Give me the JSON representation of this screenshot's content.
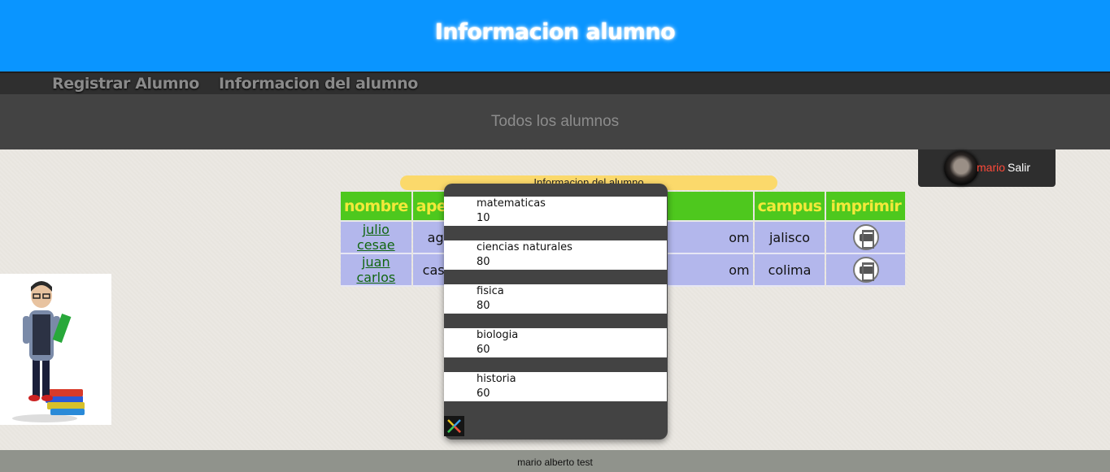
{
  "header": {
    "title": "Informacion alumno"
  },
  "nav": {
    "items": [
      {
        "label": "Registrar Alumno"
      },
      {
        "label": "Informacion del alumno"
      }
    ]
  },
  "subnav": {
    "label": "Todos los alumnos"
  },
  "user": {
    "name": "mario",
    "logout_label": "Salir"
  },
  "table": {
    "caption": "Informacion del alumno",
    "headers": [
      "nombre",
      "ape",
      "",
      "campus",
      "imprimir"
    ],
    "rows": [
      {
        "nombre": "julio cesae",
        "apellido": "agu",
        "correo": "om",
        "campus": "jalisco"
      },
      {
        "nombre": "juan carlos",
        "apellido": "cast",
        "correo": "om",
        "campus": "colima"
      }
    ]
  },
  "grades_modal": {
    "subjects": [
      {
        "name": "matematicas",
        "grade": "10"
      },
      {
        "name": "ciencias naturales",
        "grade": "80"
      },
      {
        "name": "fisica",
        "grade": "80"
      },
      {
        "name": "biologia",
        "grade": "60"
      },
      {
        "name": "historia",
        "grade": "60"
      }
    ],
    "close_icon": "close-x-icon"
  },
  "footer": {
    "text": "mario alberto test"
  },
  "colors": {
    "header_bg": "#0a95ff",
    "nav_bg": "#2f2f2f",
    "subnav_bg": "#434343",
    "table_header_bg": "#4ec81e",
    "table_header_text": "#f2e93a",
    "table_cell_bg": "#b3b7ec",
    "caption_bg": "#fbd96b",
    "footer_bg": "#90938c"
  }
}
